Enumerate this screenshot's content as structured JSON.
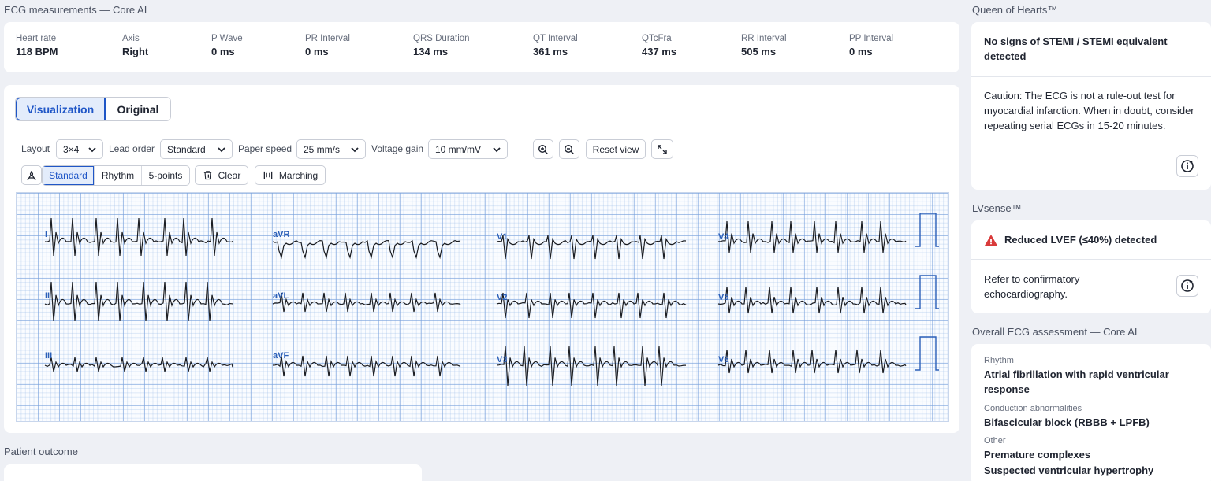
{
  "measurements": {
    "title": "ECG measurements — Core AI",
    "items": [
      {
        "label": "Heart rate",
        "value": "118 BPM"
      },
      {
        "label": "Axis",
        "value": "Right"
      },
      {
        "label": "P Wave",
        "value": "0 ms"
      },
      {
        "label": "PR Interval",
        "value": "0 ms"
      },
      {
        "label": "QRS Duration",
        "value": "134 ms"
      },
      {
        "label": "QT Interval",
        "value": "361 ms"
      },
      {
        "label": "QTcFra",
        "value": "437 ms"
      },
      {
        "label": "RR Interval",
        "value": "505 ms"
      },
      {
        "label": "PP Interval",
        "value": "0 ms"
      }
    ]
  },
  "viewer": {
    "tabs": [
      "Visualization",
      "Original"
    ],
    "layout_label": "Layout",
    "layout_value": "3×4",
    "lead_order_label": "Lead order",
    "lead_order_value": "Standard",
    "paper_speed_label": "Paper speed",
    "paper_speed_value": "25 mm/s",
    "voltage_gain_label": "Voltage gain",
    "voltage_gain_value": "10 mm/mV",
    "reset_view": "Reset view",
    "modes": [
      "Standard",
      "Rhythm",
      "5-points"
    ],
    "clear": "Clear",
    "marching": "Marching",
    "leads": [
      "I",
      "II",
      "III",
      "aVR",
      "aVL",
      "aVF",
      "V1",
      "V2",
      "V3",
      "V4",
      "V5",
      "V6"
    ]
  },
  "queen": {
    "title": "Queen of Hearts™",
    "headline": "No signs of STEMI / STEMI equivalent detected",
    "caution": "Caution: The ECG is not a rule-out test for myocardial infarction. When in doubt, consider repeating serial ECGs in 15-20 minutes."
  },
  "lvsense": {
    "title": "LVsense™",
    "headline": "Reduced LVEF (≤40%) detected",
    "note": "Refer to confirmatory echocardiography."
  },
  "overall": {
    "title": "Overall ECG assessment — Core AI",
    "rhythm_label": "Rhythm",
    "rhythm_value": "Atrial fibrillation with rapid ventricular response",
    "conduction_label": "Conduction abnormalities",
    "conduction_value": "Bifascicular block (RBBB + LPFB)",
    "other_label": "Other",
    "other_values": [
      "Premature complexes",
      "Suspected ventricular hypertrophy"
    ]
  },
  "patient_outcome": {
    "title": "Patient outcome"
  },
  "colors": {
    "accent": "#1f56c7",
    "warning": "#d93a3a",
    "grid": "#7aa0dc"
  }
}
